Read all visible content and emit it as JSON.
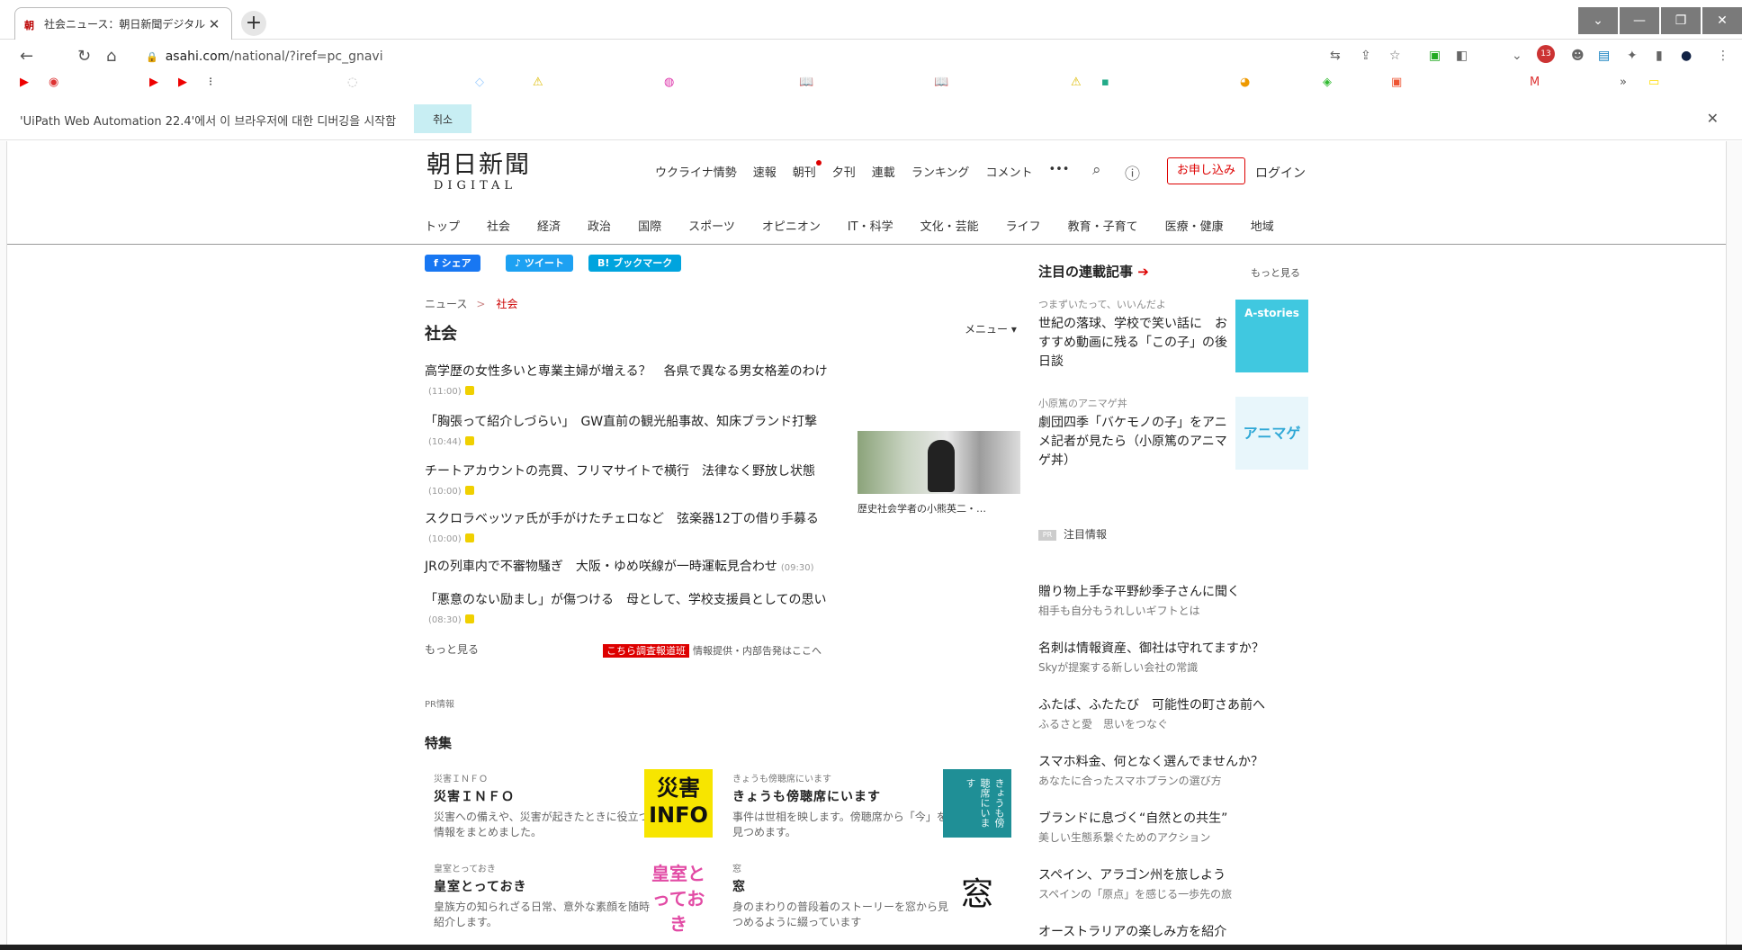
{
  "browser": {
    "tab_title": "社会ニュース：朝日新聞デジタル",
    "tab_favicon": "朝",
    "url_host": "asahi.com",
    "url_path": "/national/?iref=pc_gnavi",
    "avatar_badge": "13"
  },
  "infobar": {
    "message": "'UiPath Web Automation 22.4'에서 이 브라우저에 대한 디버깅을 시작함",
    "cancel": "취소"
  },
  "site": {
    "logo_jp": "朝日新聞",
    "logo_en": "DIGITAL",
    "topnav": [
      "ウクライナ情勢",
      "速報",
      "朝刊",
      "夕刊",
      "連載",
      "ランキング",
      "コメント",
      "•••"
    ],
    "subscribe": "お申し込み",
    "login": "ログイン",
    "categories": [
      "トップ",
      "社会",
      "経済",
      "政治",
      "国際",
      "スポーツ",
      "オピニオン",
      "IT・科学",
      "文化・芸能",
      "ライフ",
      "教育・子育て",
      "医療・健康",
      "地域"
    ]
  },
  "share": {
    "facebook": "シェア",
    "twitter": "ツイート",
    "bookmark": "ブックマーク"
  },
  "breadcrumb": {
    "root": "ニュース",
    "current": "社会"
  },
  "page_title": "社会",
  "menu_label": "メニュー ▾",
  "news": [
    {
      "title": "高学歴の女性多いと専業主婦が増える？　各県で異なる男女格差のわけ",
      "time": "(11:00)"
    },
    {
      "title": "「胸張って紹介しづらい」　GW直前の観光船事故、知床ブランド打撃",
      "time": "(10:44)"
    },
    {
      "title": "チートアカウントの売買、フリマサイトで横行　法律なく野放し状態",
      "time": "(10:00)"
    },
    {
      "title": "スクロラベッツァ氏が手がけたチェロなど　弦楽器12丁の借り手募る",
      "time": "(10:00)"
    },
    {
      "title": "JRの列車内で不審物騒ぎ　大阪・ゆめ咲線が一時運転見合わせ",
      "time": "(09:30)"
    },
    {
      "title": "「悪意のない励まし」が傷つける　母として、学校支援員としての思い",
      "time": "(08:30)"
    }
  ],
  "photo_caption": "歴史社会学者の小熊英二・…",
  "more_link": "もっと見る",
  "tip": {
    "badge": "こちら調査報道班",
    "text": "情報提供・内部告発はここへ"
  },
  "pr_label": "PR情報",
  "tokushu_title": "特集",
  "features": [
    {
      "cat": "災害ＩＮＦＯ",
      "title": "災害ＩＮＦＯ",
      "desc": "災害への備えや、災害が起きたときに役立つ情報をまとめました。",
      "thumb": "災害INFO"
    },
    {
      "cat": "きょうも傍聴席にいます",
      "title": "きょうも傍聴席にいます",
      "desc": "事件は世相を映します。傍聴席から「今」を見つめます。",
      "thumb": "きょうも傍聴席にいます"
    },
    {
      "cat": "皇室とっておき",
      "title": "皇室とっておき",
      "desc": "皇族方の知られざる日常、意外な素顔を随時紹介します。",
      "thumb": "皇室とっておき"
    },
    {
      "cat": "窓",
      "title": "窓",
      "desc": "身のまわりの普段着のストーリーを窓から見つめるように綴っています",
      "thumb": "窓"
    }
  ],
  "sidebar": {
    "header": "注目の連載記事",
    "more": "もっと見る",
    "series": [
      {
        "cat": "つまずいたって、いいんだよ",
        "title": "世紀の落球、学校で笑い話に　おすすめ動画に残る「この子」の後日談",
        "thumb": "A-stories"
      },
      {
        "cat": "小原篤のアニマゲ丼",
        "title": "劇団四季「バケモノの子」をアニメ記者が見たら（小原篤のアニマゲ丼）",
        "thumb": "アニマゲ"
      }
    ],
    "chumoku": "注目情報",
    "ads": [
      {
        "title": "贈り物上手な平野紗季子さんに聞く",
        "sub": "相手も自分もうれしいギフトとは"
      },
      {
        "title": "名刺は情報資産、御社は守れてますか？",
        "sub": "Skyが提案する新しい会社の常識"
      },
      {
        "title": "ふたば、ふたたび　可能性の町さあ前へ",
        "sub": "ふるさと愛　思いをつなぐ"
      },
      {
        "title": "スマホ料金、何となく選んでませんか？",
        "sub": "あなたに合ったスマホプランの選び方"
      },
      {
        "title": "ブランドに息づく“自然との共生”",
        "sub": "美しい生態系繋ぐためのアクション"
      },
      {
        "title": "スペイン、アラゴン州を旅しよう",
        "sub": "スペインの「原点」を感じる一歩先の旅"
      },
      {
        "title": "オーストラリアの楽しみ方を紹介",
        "sub": ""
      }
    ]
  },
  "colors": {
    "accent_red": "#dd0000",
    "facebook": "#1877f2",
    "twitter": "#1da1f2",
    "hatena": "#00a4de"
  }
}
